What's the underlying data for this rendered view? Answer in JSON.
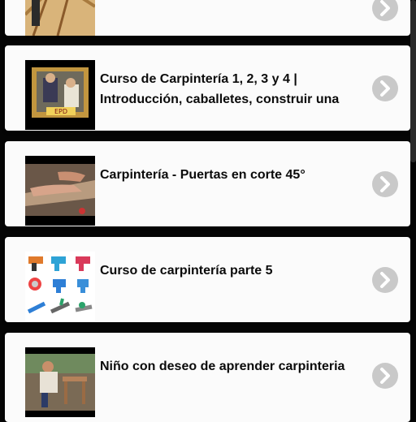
{
  "items": [
    {
      "title": "",
      "thumb": "thumb-ladder-roof-frame",
      "chevron": "chevron-right-icon"
    },
    {
      "title": "Curso de Carpintería 1, 2, 3 y 4 | Introducción, caballetes, construir una",
      "thumb": "thumb-workshop-video",
      "chevron": "chevron-right-icon"
    },
    {
      "title": "Carpintería - Puertas en corte 45°",
      "thumb": "thumb-hands-cutting-wood",
      "chevron": "chevron-right-icon"
    },
    {
      "title": "Curso de carpintería parte 5",
      "thumb": "thumb-power-tools-grid",
      "chevron": "chevron-right-icon"
    },
    {
      "title": "Niño con deseo de aprender carpinteria",
      "thumb": "thumb-child-carpentry",
      "chevron": "chevron-right-icon"
    }
  ],
  "colors": {
    "card": "#fbfbfb",
    "background": "#050505",
    "chevron": "#c9c9c9",
    "text": "#0b0b0b"
  }
}
